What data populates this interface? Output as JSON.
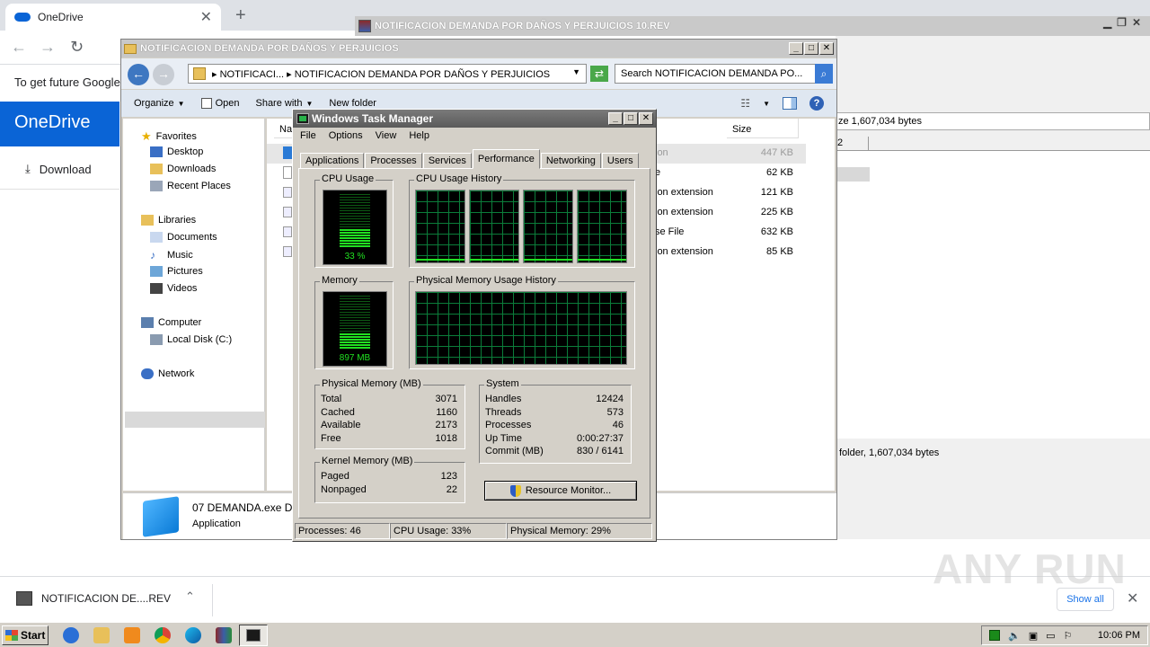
{
  "browser": {
    "tab_title": "OneDrive",
    "info_text": "To get future Google",
    "onedrive_brand": "OneDrive",
    "download_label": "Download"
  },
  "winrar": {
    "title": "NOTIFICACION DEMANDA POR DAÑOS Y PERJUICIOS 10.REV",
    "info_text": "ze 1,607,034 bytes",
    "status_text": "folder, 1,607,034 bytes",
    "column_fragment": "2"
  },
  "explorer": {
    "title": "NOTIFICACION DEMANDA POR DAÑOS Y PERJUICIOS",
    "address": "▸ NOTIFICACI... ▸ NOTIFICACION DEMANDA POR DAÑOS Y PERJUICIOS",
    "search_placeholder": "Search NOTIFICACION DEMANDA PO...",
    "commands": {
      "organize": "Organize",
      "open": "Open",
      "share_with": "Share with",
      "new_folder": "New folder"
    },
    "nav": {
      "favorites": "Favorites",
      "desktop": "Desktop",
      "downloads": "Downloads",
      "recent_places": "Recent Places",
      "libraries": "Libraries",
      "documents": "Documents",
      "music": "Music",
      "pictures": "Pictures",
      "videos": "Videos",
      "computer": "Computer",
      "local_disk": "Local Disk (C:)",
      "network": "Network"
    },
    "columns": {
      "name": "Na",
      "size": "Size"
    },
    "files": [
      {
        "type": "ion",
        "size": "447 KB"
      },
      {
        "type": "e",
        "size": "62 KB"
      },
      {
        "type": "ion extension",
        "size": "121 KB"
      },
      {
        "type": "ion extension",
        "size": "225 KB"
      },
      {
        "type": "se File",
        "size": "632 KB"
      },
      {
        "type": "ion extension",
        "size": "85 KB"
      }
    ],
    "details": {
      "name": "07 DEMANDA.exe D",
      "type": "Application"
    }
  },
  "task_manager": {
    "title": "Windows Task Manager",
    "menu": [
      "File",
      "Options",
      "View",
      "Help"
    ],
    "tabs": [
      "Applications",
      "Processes",
      "Services",
      "Performance",
      "Networking",
      "Users"
    ],
    "active_tab": "Performance",
    "cpu_usage_label": "CPU Usage",
    "cpu_usage_value": "33 %",
    "cpu_usage_fraction": 0.33,
    "cpu_history_label": "CPU Usage History",
    "memory_label": "Memory",
    "memory_value": "897 MB",
    "memory_fraction": 0.29,
    "physical_history_label": "Physical Memory Usage History",
    "physical_memory": {
      "label": "Physical Memory (MB)",
      "rows": [
        [
          "Total",
          "3071"
        ],
        [
          "Cached",
          "1160"
        ],
        [
          "Available",
          "2173"
        ],
        [
          "Free",
          "1018"
        ]
      ]
    },
    "kernel_memory": {
      "label": "Kernel Memory (MB)",
      "rows": [
        [
          "Paged",
          "123"
        ],
        [
          "Nonpaged",
          "22"
        ]
      ]
    },
    "system": {
      "label": "System",
      "rows": [
        [
          "Handles",
          "12424"
        ],
        [
          "Threads",
          "573"
        ],
        [
          "Processes",
          "46"
        ],
        [
          "Up Time",
          "0:00:27:37"
        ],
        [
          "Commit (MB)",
          "830 / 6141"
        ]
      ]
    },
    "resource_monitor_button": "Resource Monitor...",
    "status": {
      "processes": "Processes: 46",
      "cpu": "CPU Usage: 33%",
      "memory": "Physical Memory: 29%"
    }
  },
  "download_shelf": {
    "item_name": "NOTIFICACION DE....REV",
    "show_all": "Show all"
  },
  "watermark": "ANY RUN",
  "taskbar": {
    "start_label": "Start",
    "clock": "10:06 PM"
  },
  "colors": {
    "meter_green": "#21e021",
    "grid_green": "#0b7d3a",
    "onedrive_blue": "#0a64d6"
  }
}
